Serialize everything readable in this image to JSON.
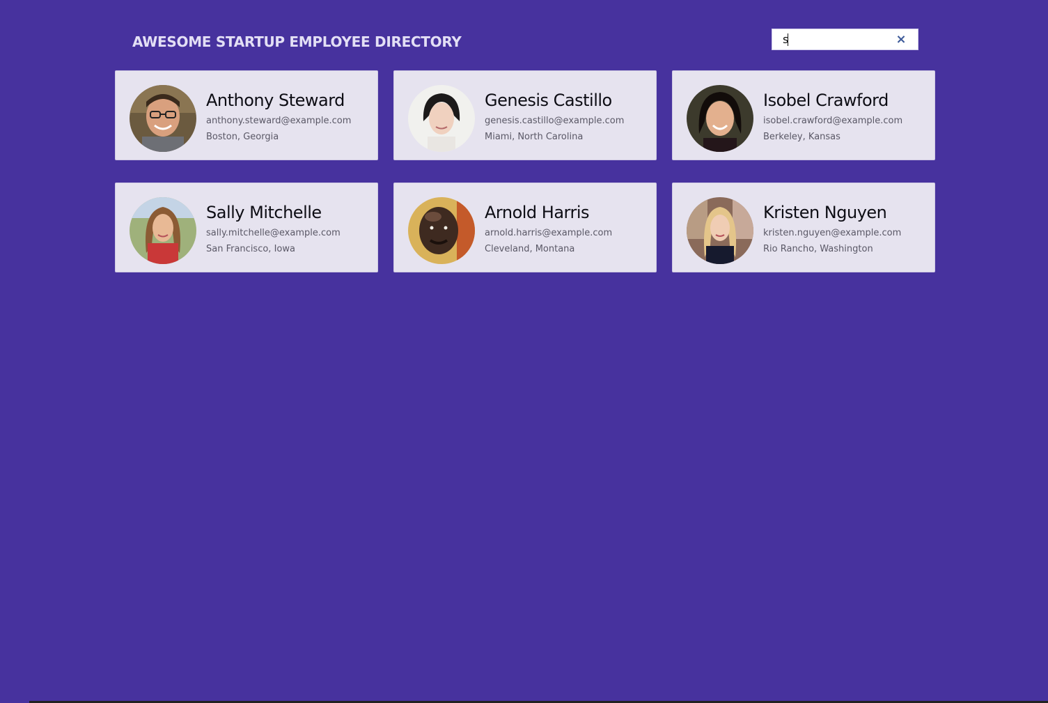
{
  "header": {
    "title": "AWESOME STARTUP EMPLOYEE DIRECTORY"
  },
  "search": {
    "value": "s",
    "clear_icon": "×"
  },
  "employees": [
    {
      "name": "Anthony Steward",
      "email": "anthony.steward@example.com",
      "location": "Boston, Georgia"
    },
    {
      "name": "Genesis Castillo",
      "email": "genesis.castillo@example.com",
      "location": "Miami, North Carolina"
    },
    {
      "name": "Isobel Crawford",
      "email": "isobel.crawford@example.com",
      "location": "Berkeley, Kansas"
    },
    {
      "name": "Sally Mitchelle",
      "email": "sally.mitchelle@example.com",
      "location": "San Francisco, Iowa"
    },
    {
      "name": "Arnold Harris",
      "email": "arnold.harris@example.com",
      "location": "Cleveland, Montana"
    },
    {
      "name": "Kristen Nguyen",
      "email": "kristen.nguyen@example.com",
      "location": "Rio Rancho, Washington"
    }
  ],
  "colors": {
    "background": "#47329e",
    "card": "#e6e3ef",
    "title": "#e3dff5",
    "clear_icon": "#3d5a99"
  }
}
